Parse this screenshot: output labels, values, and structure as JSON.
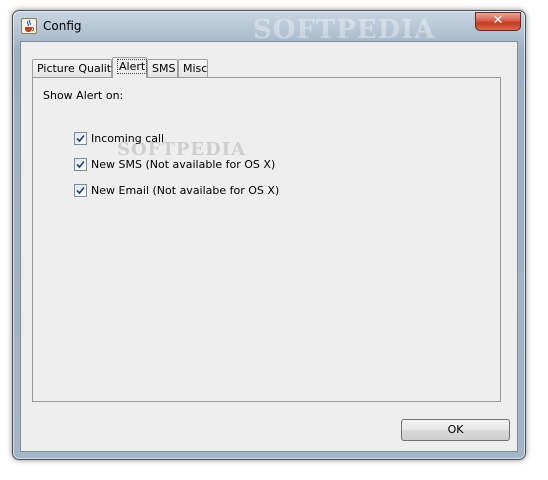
{
  "window": {
    "title": "Config",
    "watermark": "SOFTPEDIA",
    "close_glyph": "✕"
  },
  "tabs": [
    {
      "label": "Picture Quality"
    },
    {
      "label": "Alert"
    },
    {
      "label": "SMS"
    },
    {
      "label": "Misc"
    }
  ],
  "active_tab": "Alert",
  "alert_panel": {
    "heading": "Show Alert on:",
    "watermark": "SOFTPEDIA",
    "options": [
      {
        "label": "Incoming call",
        "checked": true
      },
      {
        "label": "New SMS (Not available for OS X)",
        "checked": true
      },
      {
        "label": "New Email (Not availabe for OS X)",
        "checked": true
      }
    ]
  },
  "footer": {
    "ok_label": "OK"
  }
}
